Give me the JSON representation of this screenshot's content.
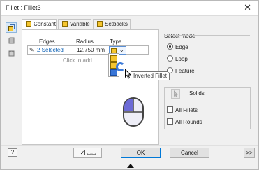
{
  "window": {
    "title": "Fillet : Fillet3",
    "close_glyph": "✕"
  },
  "tabs": [
    {
      "label": "Constant",
      "icon": "constant-fillet-icon",
      "active": true
    },
    {
      "label": "Variable",
      "icon": "variable-fillet-icon",
      "active": false
    },
    {
      "label": "Setbacks",
      "icon": "setback-icon",
      "active": false
    }
  ],
  "table": {
    "headers": {
      "edges": "Edges",
      "radius": "Radius",
      "type": "Type"
    },
    "rows": [
      {
        "edges": "2 Selected",
        "radius": "12.750 mm",
        "type_icon": "convex-fillet-icon"
      }
    ],
    "add_row_hint": "Click to add"
  },
  "tooltip": "Inverted Fillet",
  "select_mode": {
    "title": "Select mode",
    "options": [
      {
        "label": "Edge",
        "selected": true
      },
      {
        "label": "Loop",
        "selected": false
      },
      {
        "label": "Feature",
        "selected": false
      }
    ]
  },
  "solids": {
    "label": "Solids",
    "all_fillets": "All Fillets",
    "all_rounds": "All Rounds"
  },
  "footer": {
    "help_glyph": "?",
    "preview_glyph": "⌓⌓",
    "ok": "OK",
    "cancel": "Cancel",
    "more": ">>"
  },
  "colors": {
    "link_blue": "#0a5fb4",
    "fillet_icon": "#f6c62f",
    "selection": "#3875d7"
  }
}
